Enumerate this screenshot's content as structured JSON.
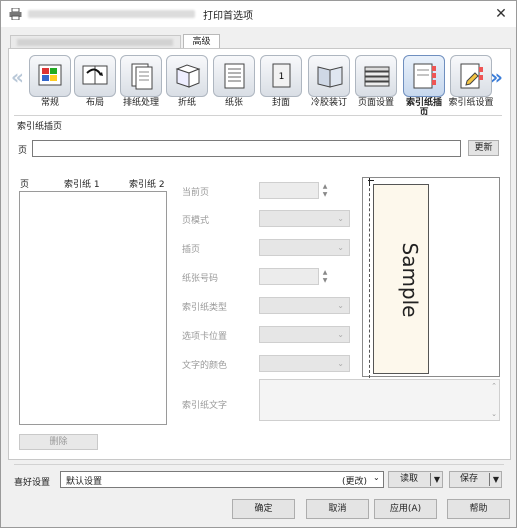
{
  "window": {
    "title": "打印首选项",
    "close_glyph": "✕",
    "app_icon": "printer-icon",
    "tabs": [
      {
        "label": ""
      },
      {
        "label": "高级"
      }
    ]
  },
  "ribbon": {
    "left_arrow": "«",
    "right_arrow": "»",
    "items": [
      {
        "label": "常规",
        "icon": "general-icon"
      },
      {
        "label": "布局",
        "icon": "layout-icon"
      },
      {
        "label": "排纸处理",
        "icon": "finishing-icon"
      },
      {
        "label": "折纸",
        "icon": "fold-icon"
      },
      {
        "label": "纸张",
        "icon": "paper-icon"
      },
      {
        "label": "封面",
        "icon": "cover-icon"
      },
      {
        "label": "冷胶装订",
        "icon": "perfect-bind-icon"
      },
      {
        "label": "页面设置",
        "icon": "page-setup-icon"
      },
      {
        "label": "索引纸插页",
        "icon": "tab-insert-icon",
        "selected": true
      },
      {
        "label": "索引纸设置",
        "icon": "tab-settings-icon"
      }
    ]
  },
  "main": {
    "section_title": "索引纸插页",
    "page_label": "页",
    "page_value": "",
    "update_button": "更新",
    "list_headers": [
      "页",
      "索引纸 1",
      "索引纸 2"
    ],
    "delete_button": "删除",
    "fields": {
      "current_page": "当前页",
      "page_mode": "页模式",
      "insert": "插页",
      "paper_number": "纸张号码",
      "tab_type": "索引纸类型",
      "tab_position": "选项卡位置",
      "text_color": "文字的颜色",
      "tab_text": "索引纸文字"
    },
    "preview_text": "Sample"
  },
  "favorites": {
    "label": "喜好设置",
    "value": "默认设置",
    "changed": "(更改)",
    "read_button": "读取",
    "save_button": "保存"
  },
  "dialog_buttons": {
    "ok": "确定",
    "cancel": "取消",
    "apply": "应用(A)",
    "help": "帮助"
  }
}
